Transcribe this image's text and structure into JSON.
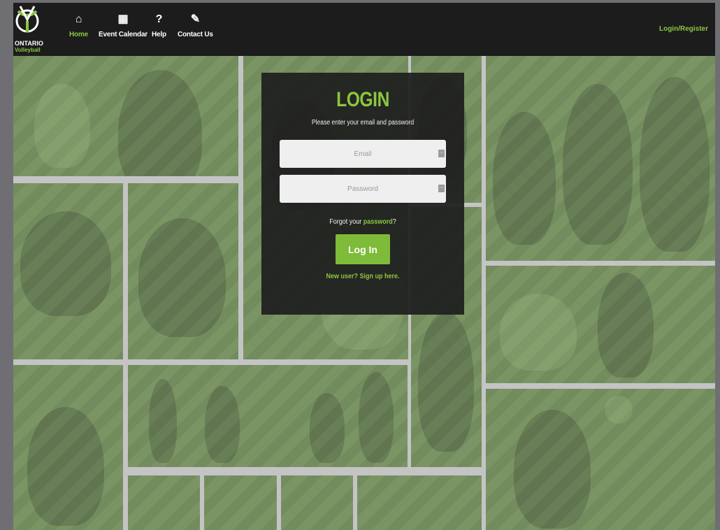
{
  "brand": {
    "logo_line1": "ONTARIO",
    "logo_line2": "Volleyball",
    "accent_color": "#8cc63f",
    "nav_bg": "#1c1c1c"
  },
  "nav": {
    "items": [
      {
        "label": "Home",
        "icon": "home-icon",
        "active": true
      },
      {
        "label": "Event Calendar",
        "icon": "calculator-icon",
        "active": false
      },
      {
        "label": "Help",
        "icon": "question-icon",
        "active": false
      },
      {
        "label": "Contact Us",
        "icon": "pencil-icon",
        "active": false
      }
    ],
    "login_register": "Login/Register"
  },
  "login": {
    "title": "LOGIN",
    "subtitle": "Please enter your email and password",
    "email_placeholder": "Email",
    "password_placeholder": "Password",
    "forgot_prefix": "Forgot your",
    "forgot_link": "password",
    "forgot_suffix": "?",
    "submit_label": "Log In",
    "signup_link": "New user? Sign up here."
  }
}
